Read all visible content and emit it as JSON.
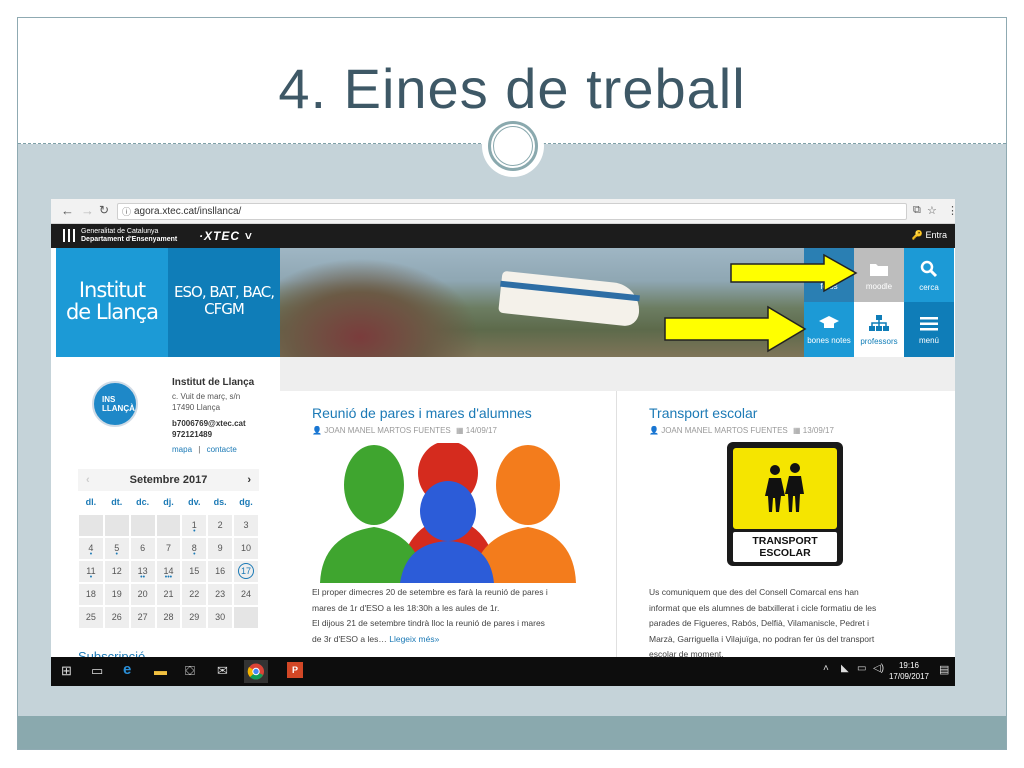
{
  "slide": {
    "title": "4. Eines de treball"
  },
  "browser": {
    "url": "agora.xtec.cat/insllanca/"
  },
  "xtec_bar": {
    "gen_line1": "Generalitat de Catalunya",
    "gen_line2": "Departament d'Ensenyament",
    "logo": "·XTEC ˅",
    "entra": "Entra"
  },
  "header": {
    "school_name_1": "Institut",
    "school_name_2": "de Llança",
    "levels_1": "ESO, BAT, BAC,",
    "levels_2": "CFGM",
    "tiles": [
      {
        "label": "fotos",
        "icon": "camera-icon"
      },
      {
        "label": "moodle",
        "icon": "folder-icon"
      },
      {
        "label": "cerca",
        "icon": "search-icon"
      },
      {
        "label": "bones notes",
        "icon": "graduation-cap-icon"
      },
      {
        "label": "professors",
        "icon": "org-chart-icon"
      },
      {
        "label": "menú",
        "icon": "menu-icon"
      }
    ],
    "arrow_color": "#ffff00"
  },
  "sidebar": {
    "logo_text": "INS LLANÇÀ",
    "name": "Institut de Llança",
    "addr1": "c. Vuit de març, s/n",
    "addr2": "17490 Llança",
    "email": "b7006769@xtec.cat",
    "phone": "972121489",
    "link_map": "mapa",
    "link_sep": "|",
    "link_contact": "contacte",
    "subscripcio": "Subscripció"
  },
  "calendar": {
    "month": "Setembre",
    "year": "2017",
    "prev": "‹",
    "next": "›",
    "dow": [
      "dl.",
      "dt.",
      "dc.",
      "dj.",
      "dv.",
      "ds.",
      "dg."
    ],
    "weeks": [
      [
        "",
        "",
        "",
        "",
        "1",
        "2",
        "3"
      ],
      [
        "4",
        "5",
        "6",
        "7",
        "8",
        "9",
        "10"
      ],
      [
        "11",
        "12",
        "13",
        "14",
        "15",
        "16",
        "17"
      ],
      [
        "18",
        "19",
        "20",
        "21",
        "22",
        "23",
        "24"
      ],
      [
        "25",
        "26",
        "27",
        "28",
        "29",
        "30",
        ""
      ]
    ],
    "today": "17"
  },
  "posts": [
    {
      "title": "Reunió de pares i mares d'alumnes",
      "author": "JOAN MANEL MARTOS FUENTES",
      "date": "14/09/17",
      "lines": [
        "El proper dimecres 20 de setembre es farà la reunió de pares i",
        "mares de 1r d'ESO a les 18:30h a les aules de 1r.",
        "El dijous 21 de setembre tindrà lloc la reunió de pares i mares",
        "de 3r d'ESO a les…"
      ],
      "more": "Llegeix més»"
    },
    {
      "title": "Transport escolar",
      "author": "JOAN MANEL MARTOS FUENTES",
      "date": "13/09/17",
      "sign_line1": "TRANSPORT",
      "sign_line2": "ESCOLAR",
      "lines": [
        "Us comuniquem que des del Consell Comarcal ens han",
        "informat que els alumnes de batxillerat i cicle formatiu de les",
        "parades de Figueres, Rabós, Delfià, Vilamaniscle, Pedret i",
        "Marzà, Garriguella  i Vilajuïga, no podran fer ús del transport",
        "escolar de moment."
      ]
    }
  ],
  "taskbar": {
    "time": "19:16",
    "date": "17/09/2017"
  },
  "colors": {
    "brand_blue": "#1c9ad6",
    "dark_blue": "#0f7db8",
    "link": "#1c7ab6"
  }
}
